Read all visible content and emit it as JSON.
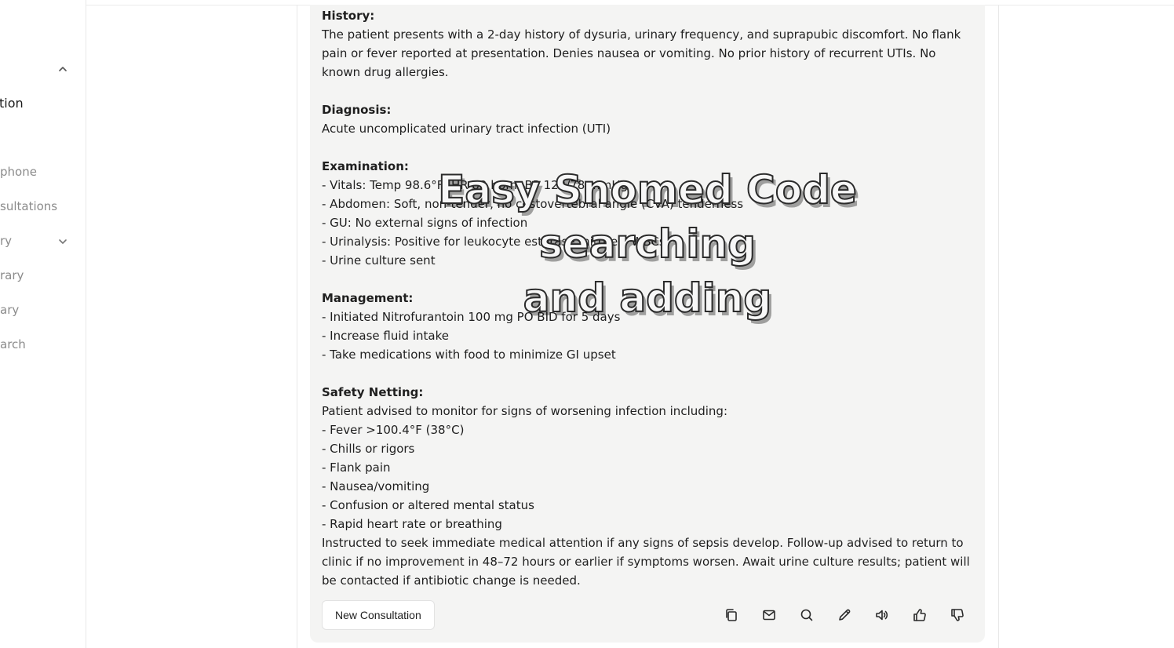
{
  "sidebar": {
    "items": [
      {
        "label": "tion",
        "active": true
      },
      {
        "label": "phone"
      },
      {
        "label": "sultations"
      },
      {
        "label": "ry"
      },
      {
        "label": "rary"
      },
      {
        "label": "ary"
      },
      {
        "label": "arch"
      }
    ]
  },
  "note": {
    "history_heading": "History:",
    "history_text": "The patient presents with a 2-day history of dysuria, urinary frequency, and suprapubic discomfort. No flank pain or fever reported at presentation. Denies nausea or vomiting. No prior history of recurrent UTIs. No known drug allergies.",
    "diagnosis_heading": "Diagnosis:",
    "diagnosis_text": "Acute uncomplicated urinary tract infection (UTI)",
    "examination_heading": "Examination:",
    "examination_items": [
      "- Vitals: Temp 98.6°F, HR 82 bpm, BP 122/78 mmHg",
      "- Abdomen: Soft, non-tender, no costovertebral angle (CVA) tenderness",
      "- GU: No external signs of infection",
      "- Urinalysis: Positive for leukocyte esterase, nitrites, WBCs",
      "- Urine culture sent"
    ],
    "management_heading": "Management:",
    "management_items": [
      "- Initiated Nitrofurantoin 100 mg PO BID for 5 days",
      "- Increase fluid intake",
      "- Take medications with food to minimize GI upset"
    ],
    "safety_heading": "Safety Netting:",
    "safety_intro": "Patient advised to monitor for signs of worsening infection including:",
    "safety_items": [
      "- Fever >100.4°F (38°C)",
      "- Chills or rigors",
      "- Flank pain",
      "- Nausea/vomiting",
      "- Confusion or altered mental status",
      "- Rapid heart rate or breathing"
    ],
    "safety_outro": "Instructed to seek immediate medical attention if any signs of sepsis develop. Follow-up advised to return to clinic if no improvement in 48–72 hours or earlier if symptoms worsen. Await urine culture results; patient will be contacted if antibiotic change is needed."
  },
  "footer": {
    "new_consultation_label": "New Consultation",
    "actions": [
      "copy-icon",
      "mail-icon",
      "search-icon",
      "pencil-icon",
      "speaker-icon",
      "thumbs-up-icon",
      "thumbs-down-icon"
    ]
  },
  "overlay": {
    "line1": "Easy Snomed Code",
    "line2": "searching",
    "line3": "and adding"
  }
}
